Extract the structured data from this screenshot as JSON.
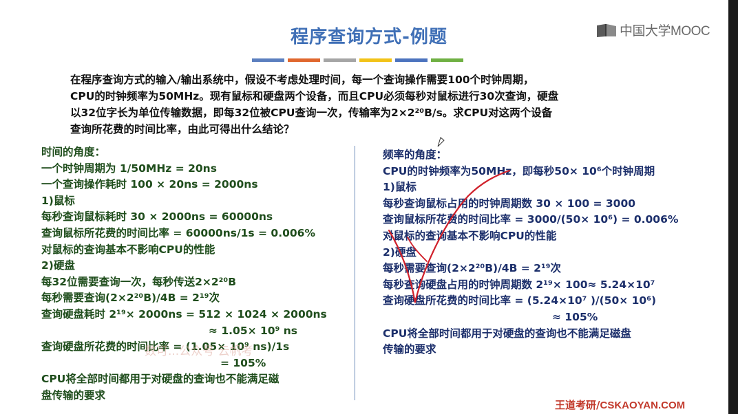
{
  "title": "程序查询方式-例题",
  "logo_text": "中国大学MOOC",
  "title_bar_colors": [
    "#5b7fbf",
    "#e0672e",
    "#a5a5a5",
    "#f2c318",
    "#4c73be",
    "#6fb043"
  ],
  "question_lines": [
    "在程序查询方式的输入/输出系统中，假设不考虑处理时间，每一个查询操作需要100个时钟周期，",
    "CPU的时钟频率为50MHz。现有鼠标和硬盘两个设备，而且CPU必须每秒对鼠标进行30次查询，硬盘",
    "以32位字长为单位传输数据，即每32位被CPU查询一次，传输率为2×2²⁰B/s。求CPU对这两个设备",
    "查询所花费的时间比率，由此可得出什么结论？"
  ],
  "left": {
    "heading": "时间的角度：",
    "lines": [
      "一个时钟周期为 1/50MHz = 20ns",
      "一个查询操作耗时 100 × 20ns = 2000ns",
      "1)鼠标",
      "每秒查询鼠标耗时 30 × 2000ns = 60000ns",
      "查询鼠标所花费的时间比率 = 60000ns/1s = 0.006%",
      "对鼠标的查询基本不影响CPU的性能",
      "2)硬盘",
      "每32位需要查询一次，每秒传送2×2²⁰B",
      "每秒需要查询(2×2²⁰B)/4B = 2¹⁹次",
      "查询硬盘耗时 2¹⁹× 2000ns = 512 × 1024 × 2000ns",
      "≈ 1.05× 10⁹ ns",
      "查询硬盘所花费的时间比率 = (1.05× 10⁹ ns)/1s",
      "= 105%",
      "CPU将全部时间都用于对硬盘的查询也不能满足磁",
      "盘传输的要求"
    ]
  },
  "right": {
    "heading": "频率的角度：",
    "lines": [
      "CPU的时钟频率为50MHz，即每秒50× 10⁶个时钟周期",
      "1)鼠标",
      "每秒查询鼠标占用的时钟周期数 30 × 100 = 3000",
      "查询鼠标所花费的时间比率 = 3000/(50× 10⁶) = 0.006%",
      "对鼠标的查询基本不影响CPU的性能",
      "2)硬盘",
      "每秒需要查询(2×2²⁰B)/4B = 2¹⁹次",
      "每秒查询硬盘占用的时钟周期数 2¹⁹× 100≈ 5.24×10⁷",
      "查询硬盘所花费的时间比率 = (5.24×10⁷ )/(50× 10⁶)",
      "≈ 105%",
      "CPU将全部时间都用于对硬盘的查询也不能满足磁盘",
      "传输的要求"
    ]
  },
  "watermark": "数可...公众号  云帆考",
  "footer": {
    "brand": "王道考研/",
    "site": "CSKAOYAN.COM"
  }
}
